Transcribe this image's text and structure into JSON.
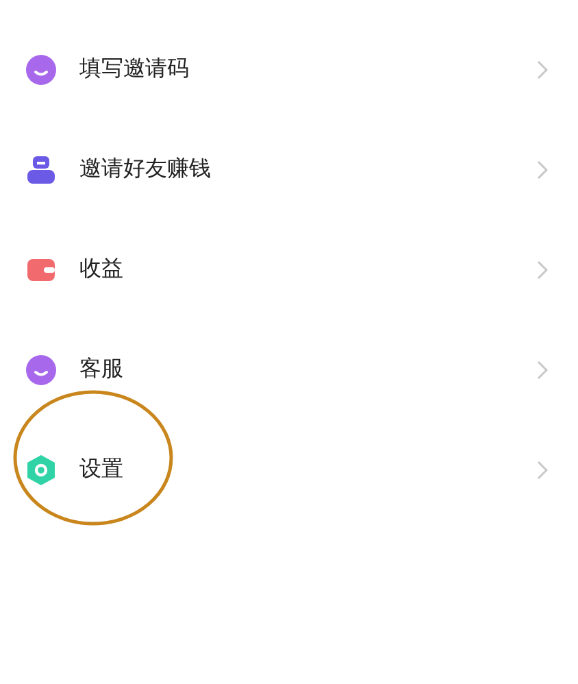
{
  "menu": [
    {
      "label": "填写邀请码",
      "kind": "smile",
      "color": "#a868ec",
      "highlighted": false
    },
    {
      "label": "邀请好友赚钱",
      "kind": "box",
      "color": "#6a5ae6",
      "highlighted": false
    },
    {
      "label": "收益",
      "kind": "wallet",
      "color": "#f06a6e",
      "highlighted": false
    },
    {
      "label": "客服",
      "kind": "smile",
      "color": "#a868ec",
      "highlighted": false
    },
    {
      "label": "设置",
      "kind": "hex",
      "color": "#2fd3a6",
      "highlighted": true
    }
  ]
}
